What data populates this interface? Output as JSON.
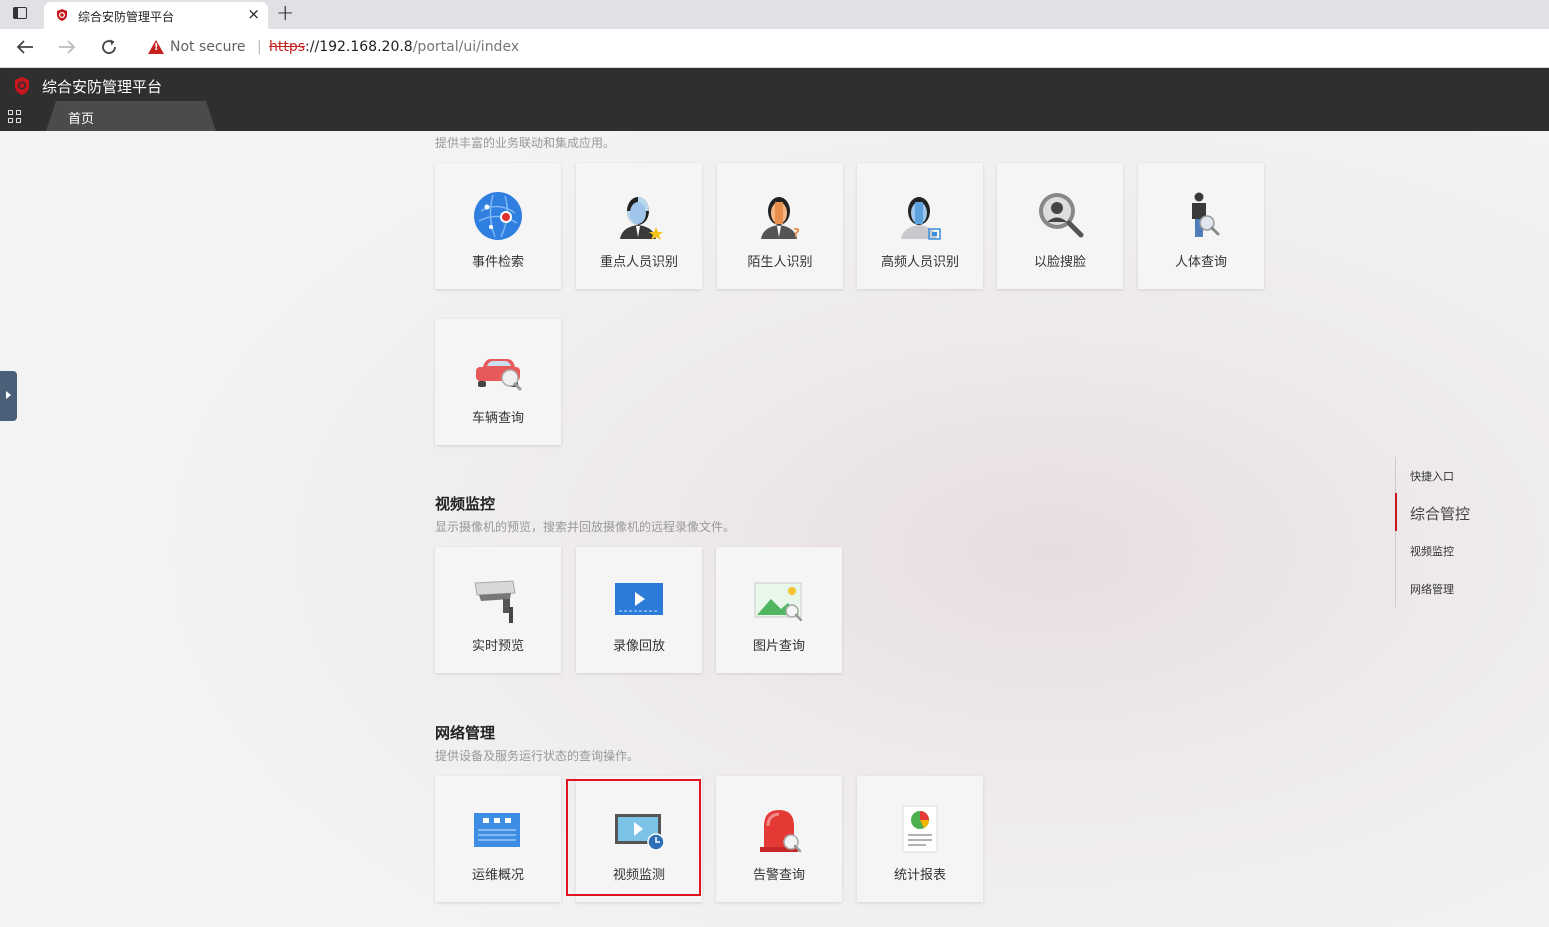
{
  "browser": {
    "tab_title": "综合安防管理平台",
    "close_glyph": "×",
    "new_tab_glyph": "+",
    "security_label": "Not secure",
    "separator": "|",
    "url_scheme": "https",
    "url_host": "://192.168.20.8",
    "url_path": "/portal/ui/index"
  },
  "app": {
    "title": "综合安防管理平台",
    "home_tab": "首页",
    "accent": "#c8161d"
  },
  "sections": {
    "integrated": {
      "desc": "提供丰富的业务联动和集成应用。",
      "cards": [
        "事件检索",
        "重点人员识别",
        "陌生人识别",
        "高频人员识别",
        "以脸搜脸",
        "人体查询",
        "车辆查询"
      ]
    },
    "video": {
      "title": "视频监控",
      "desc": "显示摄像机的预览，搜索并回放摄像机的远程录像文件。",
      "cards": [
        "实时预览",
        "录像回放",
        "图片查询"
      ]
    },
    "network": {
      "title": "网络管理",
      "desc": "提供设备及服务运行状态的查询操作。",
      "cards": [
        "运维概况",
        "视频监测",
        "告警查询",
        "统计报表"
      ]
    }
  },
  "quick_nav": {
    "items": [
      "快捷入口",
      "综合管控",
      "视频监控",
      "网络管理"
    ],
    "active": "综合管控"
  },
  "icons": [
    "event-search-icon",
    "key-person-icon",
    "stranger-icon",
    "frequent-person-icon",
    "face-search-icon",
    "body-search-icon",
    "vehicle-search-icon",
    "camera-icon",
    "playback-icon",
    "picture-icon",
    "ops-overview-icon",
    "video-monitor-icon",
    "alarm-icon",
    "report-icon"
  ]
}
